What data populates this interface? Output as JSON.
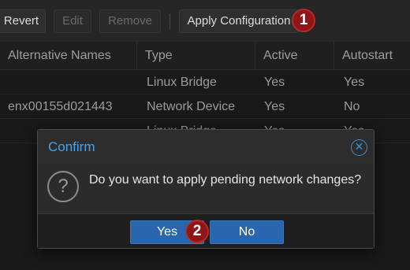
{
  "toolbar": {
    "revert_label": "Revert",
    "edit_label": "Edit",
    "remove_label": "Remove",
    "apply_label": "Apply Configuration",
    "step_badge": "1"
  },
  "grid": {
    "columns": [
      "Alternative Names",
      "Type",
      "Active",
      "Autostart"
    ],
    "rows": [
      [
        "",
        "Linux Bridge",
        "Yes",
        "Yes"
      ],
      [
        "enx00155d021443",
        "Network Device",
        "Yes",
        "No"
      ],
      [
        "",
        "Linux Bridge",
        "Yes",
        "Yes"
      ]
    ]
  },
  "dialog": {
    "title": "Confirm",
    "close_icon": "close-circle-icon",
    "question_icon": "?",
    "message": "Do you want to apply pending network changes?",
    "yes_label": "Yes",
    "no_label": "No",
    "step_badge": "2"
  },
  "colors": {
    "accent_blue": "#2966ad",
    "title_blue": "#4aa3e8",
    "badge_red": "#8e1616"
  }
}
